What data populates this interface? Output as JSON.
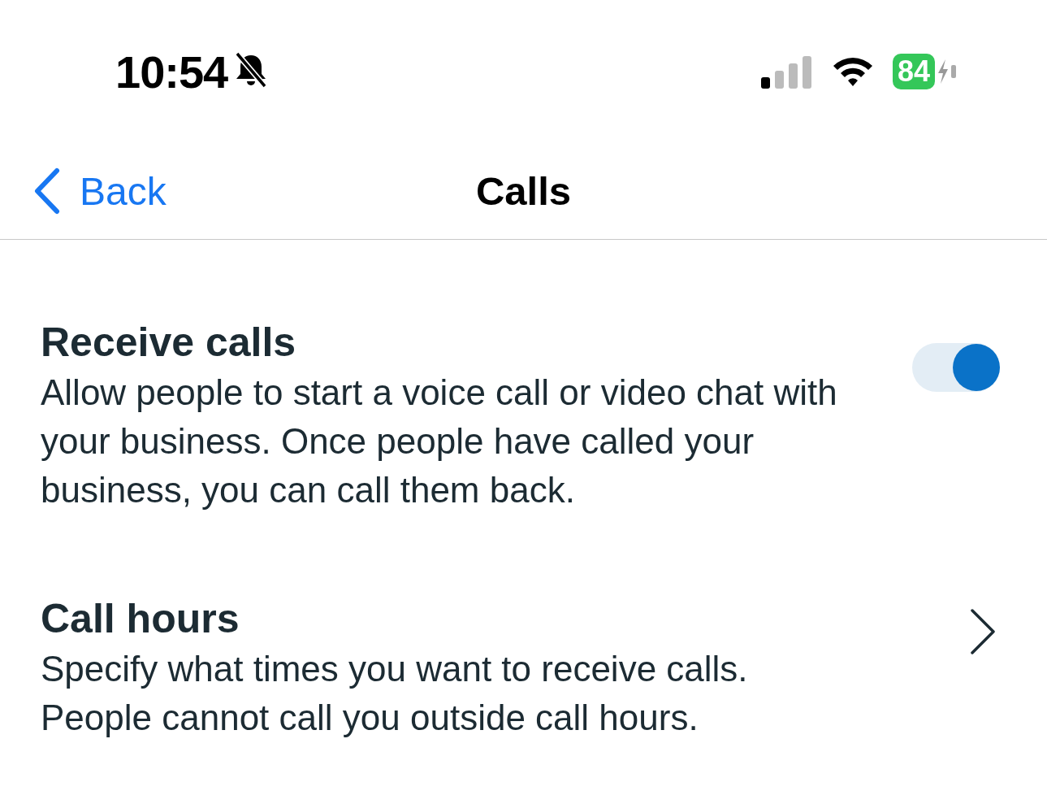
{
  "status_bar": {
    "time": "10:54",
    "silent": true,
    "battery": "84",
    "charging": true
  },
  "nav": {
    "back": "Back",
    "title": "Calls"
  },
  "settings": [
    {
      "kind": "toggle",
      "title": "Receive calls",
      "description": "Allow people to start a voice call or video chat with your business. Once people have called your business, you can call them back.",
      "on": true
    },
    {
      "kind": "link",
      "title": "Call hours",
      "description": "Specify what times you want to receive calls. People cannot call you outside call hours."
    }
  ]
}
